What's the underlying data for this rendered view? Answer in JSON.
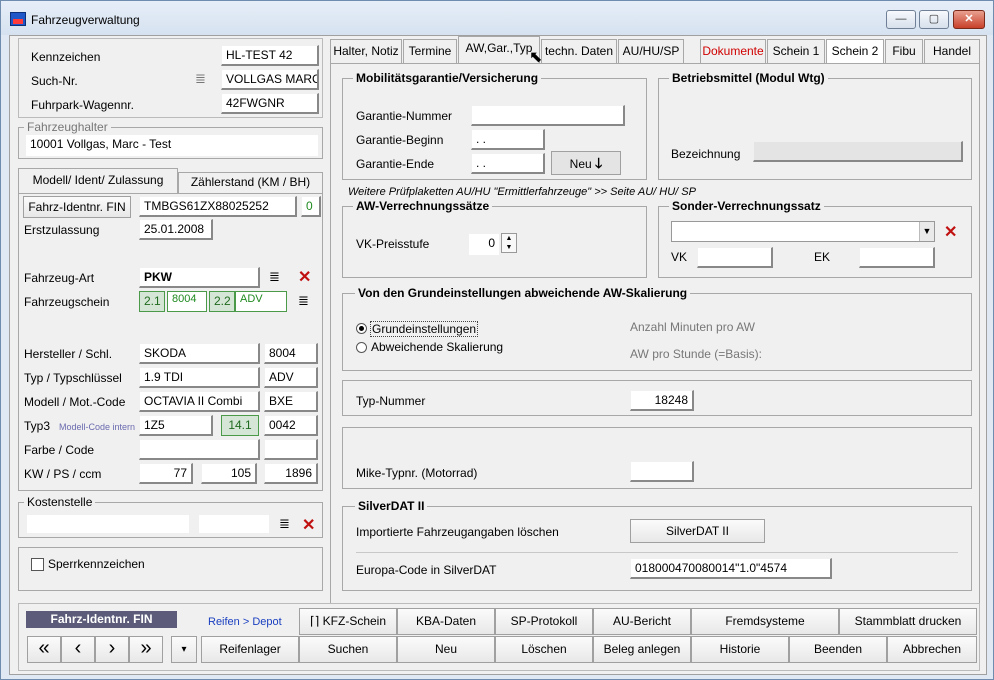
{
  "window": {
    "title": "Fahrzeugverwaltung",
    "min": "—",
    "max": "▢",
    "close": "✕"
  },
  "left": {
    "kennzeichen_label": "Kennzeichen",
    "kennzeichen": "HL-TEST 42",
    "suchnr_label": "Such-Nr.",
    "suchnr": "VOLLGAS MARC",
    "fuhrpark_label": "Fuhrpark-Wagennr.",
    "fuhrpark": "42FWGNR",
    "halter_title": "Fahrzeughalter",
    "halter": "10001 Vollgas, Marc - Test",
    "tab1": "Modell/ Ident/ Zulassung",
    "tab2": "Zählerstand (KM / BH)",
    "fin_button": "Fahrz-Identnr. FIN",
    "fin": "TMBGS61ZX88025252",
    "fin_flag": "0",
    "erst_label": "Erstzulassung",
    "erst": "25.01.2008",
    "art_label": "Fahrzeug-Art",
    "art": "PKW",
    "schein_label": "Fahrzeugschein",
    "s21": "2.1",
    "s21v": "8004",
    "s22": "2.2",
    "s22v": "ADV",
    "hersteller_label": "Hersteller / Schl.",
    "hersteller": "SKODA",
    "hersteller_code": "8004",
    "typ_label": "Typ / Typschlüssel",
    "typ": "1.9 TDI",
    "typ_code": "ADV",
    "modell_label": "Modell / Mot.-Code",
    "modell": "OCTAVIA II Combi",
    "modell_code": "BXE",
    "typ3_label": "Typ3",
    "typ3_hint": "Modell-Code intern",
    "typ3": "1Z5",
    "typ3_v": "14.1",
    "typ3_code": "0042",
    "farbe_label": "Farbe / Code",
    "kw_label": "KW / PS / ccm",
    "kw": "77",
    "ps": "105",
    "ccm": "1896",
    "kosten_title": "Kostenstelle",
    "sperr": "Sperrkennzeichen"
  },
  "tabs": [
    "Halter, Notiz",
    "Termine",
    "AW,Gar.,Typ",
    "techn. Daten",
    "AU/HU/SP",
    "Dokumente",
    "Schein 1",
    "Schein 2",
    "Fibu",
    "Handel"
  ],
  "right": {
    "mobil_title": "Mobilitätsgarantie/Versicherung",
    "gnr_label": "Garantie-Nummer",
    "gbeg_label": "Garantie-Beginn",
    "gbeg": ". .",
    "gend_label": "Garantie-Ende",
    "gend": ". .",
    "neu_button": "Neu",
    "betrieb_title": "Betriebsmittel (Modul Wtg)",
    "bez_label": "Bezeichnung",
    "hint": "Weitere Prüfplaketten AU/HU \"Ermittlerfahrzeuge\" >> Seite AU/ HU/ SP",
    "aw_title": "AW-Verrechnungssätze",
    "vk_label": "VK-Preisstufe",
    "vk": "0",
    "sonder_title": "Sonder-Verrechnungssatz",
    "sonder_vk": "VK",
    "sonder_ek": "EK",
    "skal_title": "Von den Grundeinstellungen abweichende AW-Skalierung",
    "radio1": "Grundeinstellungen",
    "radio2": "Abweichende Skalierung",
    "min_label": "Anzahl Minuten pro AW",
    "aw_label": "AW pro Stunde (=Basis):",
    "typnr_label": "Typ-Nummer",
    "typnr": "18248",
    "mike_label": "Mike-Typnr. (Motorrad)",
    "silver_title": "SilverDAT II",
    "silver_del": "Importierte Fahrzeugangaben löschen",
    "silver_btn": "SilverDAT II",
    "euro_label": "Europa-Code in SilverDAT",
    "euro": "018000470080014\"1.0\"4574"
  },
  "bottom": {
    "fin_badge": "Fahrz-Identnr. FIN",
    "reifen": "Reifen > Depot",
    "row1": [
      "KFZ-Schein",
      "KBA-Daten",
      "SP-Protokoll",
      "AU-Bericht",
      "Fremdsysteme",
      "Stammblatt drucken"
    ],
    "nav": [
      "«",
      "‹",
      "›",
      "»",
      "▾"
    ],
    "row2": [
      "Reifenlager",
      "Suchen",
      "Neu",
      "Löschen",
      "Beleg anlegen",
      "Historie",
      "Beenden",
      "Abbrechen"
    ]
  }
}
